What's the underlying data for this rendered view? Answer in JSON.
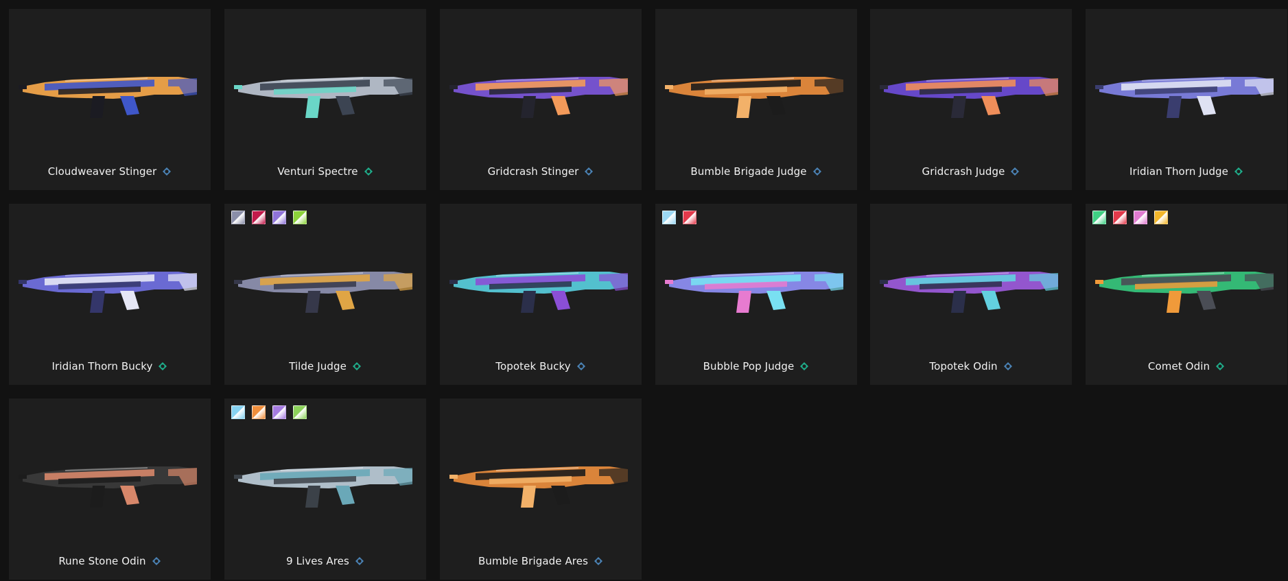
{
  "cards": [
    {
      "name": "Cloudweaver Stinger",
      "tier": "select",
      "tier_icon": "blue-tier-icon",
      "palette": [
        "#f0a44a",
        "#3f57c9",
        "#1b1b22"
      ],
      "swatches": []
    },
    {
      "name": "Venturi Spectre",
      "tier": "deluxe",
      "tier_icon": "green-tier-icon",
      "palette": [
        "#b7c0cc",
        "#3c4452",
        "#6ad6c7"
      ],
      "swatches": []
    },
    {
      "name": "Gridcrash Stinger",
      "tier": "select",
      "tier_icon": "blue-tier-icon",
      "palette": [
        "#7a55d6",
        "#f39a5a",
        "#24242e"
      ],
      "swatches": []
    },
    {
      "name": "Bumble Brigade Judge",
      "tier": "select",
      "tier_icon": "blue-tier-icon",
      "palette": [
        "#e58a3c",
        "#1c1c1c",
        "#f2b169"
      ],
      "swatches": []
    },
    {
      "name": "Gridcrash Judge",
      "tier": "select",
      "tier_icon": "blue-tier-icon",
      "palette": [
        "#6a4bd3",
        "#ef8e5a",
        "#2a2a38"
      ],
      "swatches": []
    },
    {
      "name": "Iridian Thorn Judge",
      "tier": "deluxe",
      "tier_icon": "green-tier-icon",
      "palette": [
        "#7d7fe0",
        "#dfe2f3",
        "#3a3d6e"
      ],
      "swatches": []
    },
    {
      "name": "Iridian Thorn Bucky",
      "tier": "deluxe",
      "tier_icon": "green-tier-icon",
      "palette": [
        "#6f6fdd",
        "#e6e7f5",
        "#34366a"
      ],
      "swatches": []
    },
    {
      "name": "Tilde Judge",
      "tier": "deluxe",
      "tier_icon": "green-tier-icon",
      "palette": [
        "#8c8fae",
        "#e0a545",
        "#36384a"
      ],
      "swatches": [
        "#8a8ea8",
        "#c21a4b",
        "#8f73d8",
        "#8cd23a"
      ]
    },
    {
      "name": "Topotek Bucky",
      "tier": "select",
      "tier_icon": "blue-tier-icon",
      "palette": [
        "#56c9d8",
        "#8b4fd6",
        "#2b2f4a"
      ],
      "swatches": []
    },
    {
      "name": "Bubble Pop Judge",
      "tier": "deluxe",
      "tier_icon": "green-tier-icon",
      "palette": [
        "#8c8df0",
        "#79e0f2",
        "#e77bd0"
      ],
      "swatches": [
        "#9bd8f4",
        "#e2394b"
      ]
    },
    {
      "name": "Topotek Odin",
      "tier": "select",
      "tier_icon": "blue-tier-icon",
      "palette": [
        "#9a5ad8",
        "#63d0e0",
        "#2b2f4a"
      ],
      "swatches": []
    },
    {
      "name": "Comet Odin",
      "tier": "deluxe",
      "tier_icon": "green-tier-icon",
      "palette": [
        "#36c27a",
        "#4a4d55",
        "#f09a3a"
      ],
      "swatches": [
        "#3fcf83",
        "#e2394b",
        "#e07bd0",
        "#f2b62a"
      ]
    },
    {
      "name": "Rune Stone Odin",
      "tier": "select",
      "tier_icon": "blue-tier-icon",
      "palette": [
        "#3a3a3a",
        "#d7876a",
        "#1c1c1c"
      ],
      "swatches": []
    },
    {
      "name": "9 Lives Ares",
      "tier": "select",
      "tier_icon": "blue-tier-icon",
      "palette": [
        "#b7c7d3",
        "#6aa8b8",
        "#3b4148"
      ],
      "swatches": [
        "#86d2f1",
        "#ef8e3c",
        "#a57be0",
        "#8cd25a"
      ]
    },
    {
      "name": "Bumble Brigade Ares",
      "tier": "select",
      "tier_icon": "blue-tier-icon",
      "palette": [
        "#e58a3c",
        "#1c1c1c",
        "#f2b169"
      ],
      "swatches": []
    }
  ],
  "tier_colors": {
    "select": "#4b83b6",
    "deluxe": "#1fae8b"
  }
}
